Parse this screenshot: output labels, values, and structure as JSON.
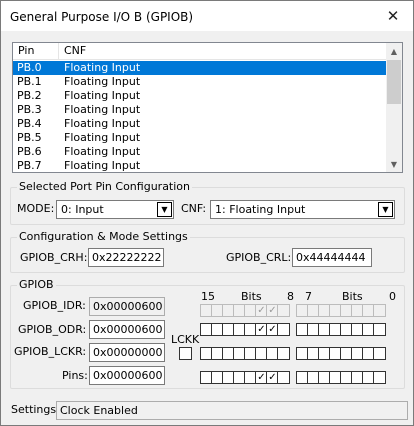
{
  "window": {
    "title": "General Purpose I/O B (GPIOB)"
  },
  "icons": {
    "close": "close-icon",
    "scroll_up": "scroll-up-icon",
    "scroll_down": "scroll-down-icon",
    "dropdown": "chevron-down-icon",
    "check": "checkmark-icon"
  },
  "pin_list": {
    "columns": {
      "pin": "Pin",
      "cnf": "CNF"
    },
    "selected_index": 0,
    "rows": [
      {
        "pin": "PB.0",
        "cnf": "Floating Input"
      },
      {
        "pin": "PB.1",
        "cnf": "Floating Input"
      },
      {
        "pin": "PB.2",
        "cnf": "Floating Input"
      },
      {
        "pin": "PB.3",
        "cnf": "Floating Input"
      },
      {
        "pin": "PB.4",
        "cnf": "Floating Input"
      },
      {
        "pin": "PB.5",
        "cnf": "Floating Input"
      },
      {
        "pin": "PB.6",
        "cnf": "Floating Input"
      },
      {
        "pin": "PB.7",
        "cnf": "Floating Input"
      }
    ]
  },
  "port_pin": {
    "label": "Selected Port Pin Configuration",
    "mode_label": "MODE:",
    "mode_value": "0: Input",
    "cnf_label": "CNF:",
    "cnf_value": "1: Floating Input"
  },
  "config": {
    "label": "Configuration & Mode Settings",
    "crh_label": "GPIOB_CRH:",
    "crh_value": "0x22222222",
    "crl_label": "GPIOB_CRL:",
    "crl_value": "0x44444444"
  },
  "gpiob": {
    "label": "GPIOB",
    "bits_header": {
      "hi": "15",
      "bits": "Bits",
      "eight": "8",
      "seven": "7",
      "bits2": "Bits",
      "lo": "0"
    },
    "idr_label": "GPIOB_IDR:",
    "idr_value": "0x00000600",
    "odr_label": "GPIOB_ODR:",
    "odr_value": "0x00000600",
    "lckr_label": "GPIOB_LCKR:",
    "lckr_value": "0x00000000",
    "lckk_label": "LCKK",
    "lckk_checked": false,
    "pins_label": "Pins:",
    "pins_value": "0x00000600",
    "rows": {
      "idr": {
        "mask": 1536,
        "enabled": false
      },
      "odr": {
        "mask": 1536,
        "enabled": true
      },
      "lckr": {
        "mask": 0,
        "enabled": true
      },
      "pins": {
        "mask": 1536,
        "enabled": true
      }
    }
  },
  "status": {
    "label": "Settings:",
    "value": "Clock Enabled"
  }
}
